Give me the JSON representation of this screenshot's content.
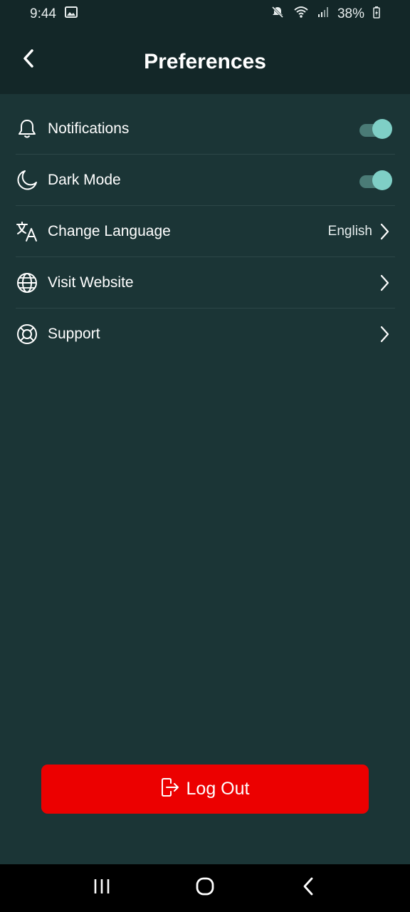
{
  "status_bar": {
    "time": "9:44",
    "battery": "38%",
    "icons": [
      "image-notification-icon",
      "mute-icon",
      "wifi-icon",
      "signal-icon",
      "battery-charging-icon"
    ]
  },
  "header": {
    "title": "Preferences",
    "back_icon": "chevron-left-icon"
  },
  "settings": [
    {
      "label": "Notifications",
      "icon": "bell-icon",
      "control": "toggle",
      "enabled": true
    },
    {
      "label": "Dark Mode",
      "icon": "moon-icon",
      "control": "toggle",
      "enabled": true
    },
    {
      "label": "Change Language",
      "icon": "translate-icon",
      "control": "link",
      "value": "English"
    },
    {
      "label": "Visit Website",
      "icon": "globe-icon",
      "control": "link"
    },
    {
      "label": "Support",
      "icon": "lifebuoy-icon",
      "control": "link"
    }
  ],
  "logout": {
    "label": "Log Out",
    "icon": "logout-icon"
  },
  "nav_bar": {
    "buttons": [
      "recent-apps-icon",
      "home-icon",
      "back-icon"
    ]
  },
  "colors": {
    "background": "#1b3536",
    "header": "#132728",
    "toggle_thumb": "#7fcfc6",
    "toggle_track": "#4a7b76",
    "logout": "#ec0000"
  }
}
